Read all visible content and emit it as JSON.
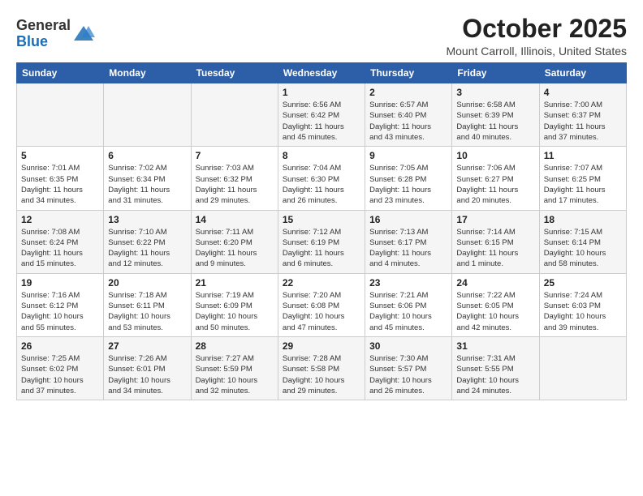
{
  "logo": {
    "general": "General",
    "blue": "Blue"
  },
  "title": "October 2025",
  "subtitle": "Mount Carroll, Illinois, United States",
  "days_of_week": [
    "Sunday",
    "Monday",
    "Tuesday",
    "Wednesday",
    "Thursday",
    "Friday",
    "Saturday"
  ],
  "weeks": [
    [
      {
        "day": "",
        "info": ""
      },
      {
        "day": "",
        "info": ""
      },
      {
        "day": "",
        "info": ""
      },
      {
        "day": "1",
        "info": "Sunrise: 6:56 AM\nSunset: 6:42 PM\nDaylight: 11 hours\nand 45 minutes."
      },
      {
        "day": "2",
        "info": "Sunrise: 6:57 AM\nSunset: 6:40 PM\nDaylight: 11 hours\nand 43 minutes."
      },
      {
        "day": "3",
        "info": "Sunrise: 6:58 AM\nSunset: 6:39 PM\nDaylight: 11 hours\nand 40 minutes."
      },
      {
        "day": "4",
        "info": "Sunrise: 7:00 AM\nSunset: 6:37 PM\nDaylight: 11 hours\nand 37 minutes."
      }
    ],
    [
      {
        "day": "5",
        "info": "Sunrise: 7:01 AM\nSunset: 6:35 PM\nDaylight: 11 hours\nand 34 minutes."
      },
      {
        "day": "6",
        "info": "Sunrise: 7:02 AM\nSunset: 6:34 PM\nDaylight: 11 hours\nand 31 minutes."
      },
      {
        "day": "7",
        "info": "Sunrise: 7:03 AM\nSunset: 6:32 PM\nDaylight: 11 hours\nand 29 minutes."
      },
      {
        "day": "8",
        "info": "Sunrise: 7:04 AM\nSunset: 6:30 PM\nDaylight: 11 hours\nand 26 minutes."
      },
      {
        "day": "9",
        "info": "Sunrise: 7:05 AM\nSunset: 6:28 PM\nDaylight: 11 hours\nand 23 minutes."
      },
      {
        "day": "10",
        "info": "Sunrise: 7:06 AM\nSunset: 6:27 PM\nDaylight: 11 hours\nand 20 minutes."
      },
      {
        "day": "11",
        "info": "Sunrise: 7:07 AM\nSunset: 6:25 PM\nDaylight: 11 hours\nand 17 minutes."
      }
    ],
    [
      {
        "day": "12",
        "info": "Sunrise: 7:08 AM\nSunset: 6:24 PM\nDaylight: 11 hours\nand 15 minutes."
      },
      {
        "day": "13",
        "info": "Sunrise: 7:10 AM\nSunset: 6:22 PM\nDaylight: 11 hours\nand 12 minutes."
      },
      {
        "day": "14",
        "info": "Sunrise: 7:11 AM\nSunset: 6:20 PM\nDaylight: 11 hours\nand 9 minutes."
      },
      {
        "day": "15",
        "info": "Sunrise: 7:12 AM\nSunset: 6:19 PM\nDaylight: 11 hours\nand 6 minutes."
      },
      {
        "day": "16",
        "info": "Sunrise: 7:13 AM\nSunset: 6:17 PM\nDaylight: 11 hours\nand 4 minutes."
      },
      {
        "day": "17",
        "info": "Sunrise: 7:14 AM\nSunset: 6:15 PM\nDaylight: 11 hours\nand 1 minute."
      },
      {
        "day": "18",
        "info": "Sunrise: 7:15 AM\nSunset: 6:14 PM\nDaylight: 10 hours\nand 58 minutes."
      }
    ],
    [
      {
        "day": "19",
        "info": "Sunrise: 7:16 AM\nSunset: 6:12 PM\nDaylight: 10 hours\nand 55 minutes."
      },
      {
        "day": "20",
        "info": "Sunrise: 7:18 AM\nSunset: 6:11 PM\nDaylight: 10 hours\nand 53 minutes."
      },
      {
        "day": "21",
        "info": "Sunrise: 7:19 AM\nSunset: 6:09 PM\nDaylight: 10 hours\nand 50 minutes."
      },
      {
        "day": "22",
        "info": "Sunrise: 7:20 AM\nSunset: 6:08 PM\nDaylight: 10 hours\nand 47 minutes."
      },
      {
        "day": "23",
        "info": "Sunrise: 7:21 AM\nSunset: 6:06 PM\nDaylight: 10 hours\nand 45 minutes."
      },
      {
        "day": "24",
        "info": "Sunrise: 7:22 AM\nSunset: 6:05 PM\nDaylight: 10 hours\nand 42 minutes."
      },
      {
        "day": "25",
        "info": "Sunrise: 7:24 AM\nSunset: 6:03 PM\nDaylight: 10 hours\nand 39 minutes."
      }
    ],
    [
      {
        "day": "26",
        "info": "Sunrise: 7:25 AM\nSunset: 6:02 PM\nDaylight: 10 hours\nand 37 minutes."
      },
      {
        "day": "27",
        "info": "Sunrise: 7:26 AM\nSunset: 6:01 PM\nDaylight: 10 hours\nand 34 minutes."
      },
      {
        "day": "28",
        "info": "Sunrise: 7:27 AM\nSunset: 5:59 PM\nDaylight: 10 hours\nand 32 minutes."
      },
      {
        "day": "29",
        "info": "Sunrise: 7:28 AM\nSunset: 5:58 PM\nDaylight: 10 hours\nand 29 minutes."
      },
      {
        "day": "30",
        "info": "Sunrise: 7:30 AM\nSunset: 5:57 PM\nDaylight: 10 hours\nand 26 minutes."
      },
      {
        "day": "31",
        "info": "Sunrise: 7:31 AM\nSunset: 5:55 PM\nDaylight: 10 hours\nand 24 minutes."
      },
      {
        "day": "",
        "info": ""
      }
    ]
  ]
}
